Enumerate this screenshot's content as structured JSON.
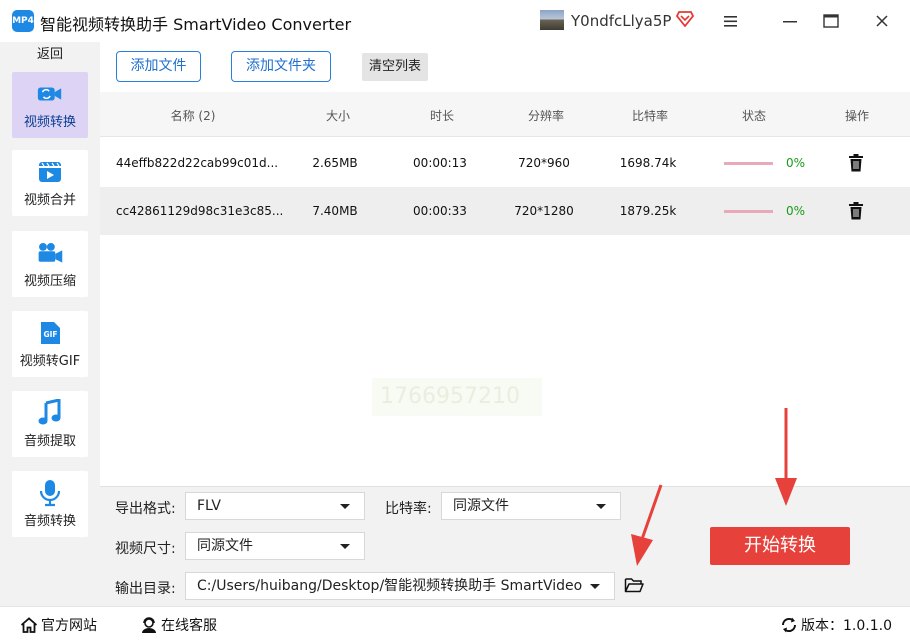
{
  "app": {
    "logo_text": "MP4",
    "title": "智能视频转换助手 SmartVideo Converter",
    "user_name": "Y0ndfcLlya5P"
  },
  "sidebar": {
    "back_label": "返回",
    "items": [
      {
        "label": "视频转换",
        "icon": "video-convert-icon",
        "active": true
      },
      {
        "label": "视频合并",
        "icon": "video-merge-icon",
        "active": false
      },
      {
        "label": "视频压缩",
        "icon": "video-compress-icon",
        "active": false
      },
      {
        "label": "视频转GIF",
        "icon": "gif-icon",
        "active": false
      },
      {
        "label": "音频提取",
        "icon": "music-note-icon",
        "active": false
      },
      {
        "label": "音频转换",
        "icon": "microphone-icon",
        "active": false
      }
    ]
  },
  "toolbar": {
    "add_file": "添加文件",
    "add_folder": "添加文件夹",
    "clear_list": "清空列表"
  },
  "table": {
    "headers": {
      "name": "名称 (2)",
      "size": "大小",
      "duration": "时长",
      "resolution": "分辨率",
      "bitrate": "比特率",
      "status": "状态",
      "actions": "操作"
    },
    "rows": [
      {
        "name": "44effb822d22cab99c01d...",
        "size": "2.65MB",
        "duration": "00:00:13",
        "resolution": "720*960",
        "bitrate": "1698.74k",
        "progress": "0%"
      },
      {
        "name": "cc42861129d98c31e3c85...",
        "size": "7.40MB",
        "duration": "00:00:33",
        "resolution": "720*1280",
        "bitrate": "1879.25k",
        "progress": "0%"
      }
    ]
  },
  "watermark": "1766957210",
  "settings": {
    "format_label": "导出格式:",
    "format_value": "FLV",
    "bitrate_label": "比特率:",
    "bitrate_value": "同源文件",
    "size_label": "视频尺寸:",
    "size_value": "同源文件",
    "output_label": "输出目录:",
    "output_value": "C:/Users/huibang/Desktop/智能视频转换助手 SmartVideo",
    "start_button": "开始转换"
  },
  "statusbar": {
    "website": "官方网站",
    "support": "在线客服",
    "version": "版本：1.0.1.0"
  },
  "colors": {
    "accent": "#1f6fcf",
    "start_button": "#e6413b",
    "active_nav": "#dcd3f5",
    "progress_text": "#1a9a1a"
  }
}
